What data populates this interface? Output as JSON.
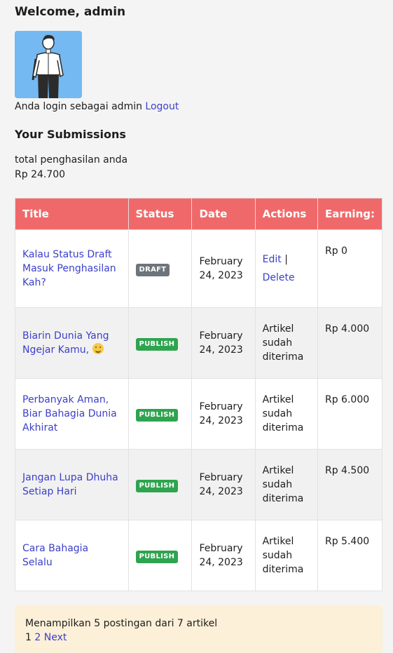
{
  "header": {
    "welcome": "Welcome, admin"
  },
  "user": {
    "login_text": "Anda login sebagai admin",
    "logout_label": "Logout"
  },
  "submissions": {
    "heading": "Your Submissions",
    "earnings_label": "total penghasilan anda",
    "earnings_total": "Rp 24.700"
  },
  "table": {
    "headers": [
      "Title",
      "Status",
      "Date",
      "Actions",
      "Earning:"
    ],
    "rows": [
      {
        "title": "Kalau Status Draft Masuk Penghasilan Kah?",
        "status": "DRAFT",
        "date": "February 24, 2023",
        "action_edit": "Edit",
        "action_sep": "|",
        "action_delete": "Delete",
        "earning": "Rp 0"
      },
      {
        "title": "Biarin Dunia Yang Ngejar Kamu,",
        "emoji": "slightly-smiling-face-icon",
        "status": "PUBLISH",
        "date": "February 24, 2023",
        "action": "Artikel sudah diterima",
        "earning": "Rp 4.000"
      },
      {
        "title": "Perbanyak Aman, Biar Bahagia Dunia Akhirat",
        "status": "PUBLISH",
        "date": "February 24, 2023",
        "action": "Artikel sudah diterima",
        "earning": "Rp 6.000"
      },
      {
        "title": "Jangan Lupa Dhuha Setiap Hari",
        "status": "PUBLISH",
        "date": "February 24, 2023",
        "action": "Artikel sudah diterima",
        "earning": "Rp 4.500"
      },
      {
        "title": "Cara Bahagia Selalu",
        "status": "PUBLISH",
        "date": "February 24, 2023",
        "action": "Artikel sudah diterima",
        "earning": "Rp 5.400"
      }
    ]
  },
  "pagination": {
    "summary": "Menampilkan 5 postingan dari 7 artikel",
    "current_page": "1",
    "page_2": "2",
    "next_label": "Next"
  },
  "colors": {
    "table_header": "#f0696a",
    "link": "#3b3fc9",
    "badge_draft": "#6d747b",
    "badge_publish": "#2ea44f",
    "pager_bg": "#fdf0d8"
  }
}
